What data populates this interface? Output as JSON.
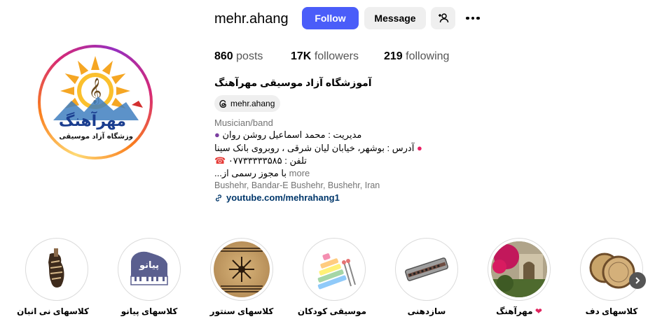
{
  "profile": {
    "username": "mehr.ahang",
    "follow_label": "Follow",
    "message_label": "Message",
    "posts_count": "860",
    "posts_label": "posts",
    "followers_count": "17K",
    "followers_label": "followers",
    "following_count": "219",
    "following_label": "following",
    "avatar_text_main": "مهرآهنگ",
    "avatar_text_sub": "آموزشگاه آزاد موسیقی"
  },
  "bio": {
    "name": "آموزشگاه آزاد موسیقی مهرآهنگ",
    "threads_handle": "mehr.ahang",
    "category": "Musician/band",
    "line1": "مدیریت : محمد اسماعیل روشن روان",
    "line2": "آدرس : بوشهر، خیابان لیان شرقی ، روبروی بانک سینا",
    "line3": "تلفن : ۰۷۷۳۳۳۳۳۵۸۵",
    "line4": "با مجوز رسمی از...",
    "more_label": "more",
    "location": "Bushehr, Bandar-E Bushehr, Bushehr, Iran",
    "link": "youtube.com/mehrahang1"
  },
  "highlights": [
    {
      "label": "کلاسهای نی انبان"
    },
    {
      "label": "کلاسهای پیانو",
      "image_text": "پیانو"
    },
    {
      "label": "کلاسهای سنتور"
    },
    {
      "label": "موسیقی کودکان"
    },
    {
      "label": "سازدهنی"
    },
    {
      "label": "مهرآهنگ",
      "emoji": "❤"
    },
    {
      "label": "کلاسهای دف"
    }
  ],
  "colors": {
    "follow_button": "#4a5df9",
    "secondary_button": "#efefef",
    "link": "#00376b",
    "muted": "#737373",
    "avatar_title": "#1a3d8f",
    "sun": "#f5a623"
  },
  "icons": {
    "add_user": "person-plus-icon",
    "more": "three-dots-icon",
    "threads": "threads-icon",
    "link": "chain-link-icon",
    "next": "chevron-right-icon"
  }
}
